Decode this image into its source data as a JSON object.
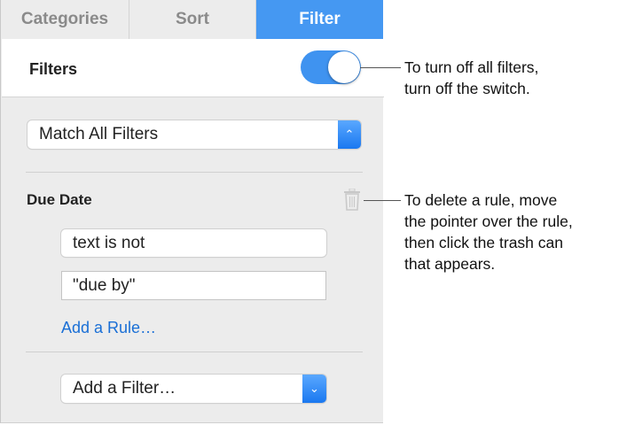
{
  "tabs": [
    {
      "label": "Categories"
    },
    {
      "label": "Sort"
    },
    {
      "label": "Filter",
      "active": true
    }
  ],
  "filters": {
    "title": "Filters",
    "enabled": true
  },
  "match_popup": {
    "value": "Match All Filters"
  },
  "rule": {
    "title": "Due Date",
    "condition": "text is not",
    "value": "\"due by\"",
    "add_rule": "Add a Rule…"
  },
  "add_filter": {
    "value": "Add a Filter…"
  },
  "callouts": {
    "toggle": [
      "To turn off all filters,",
      "turn off the switch."
    ],
    "trash": [
      "To delete a rule, move",
      "the pointer over the rule,",
      "then click the trash can",
      "that appears."
    ]
  },
  "colors": {
    "accent": "#4598f2",
    "link": "#1a6fd6"
  }
}
